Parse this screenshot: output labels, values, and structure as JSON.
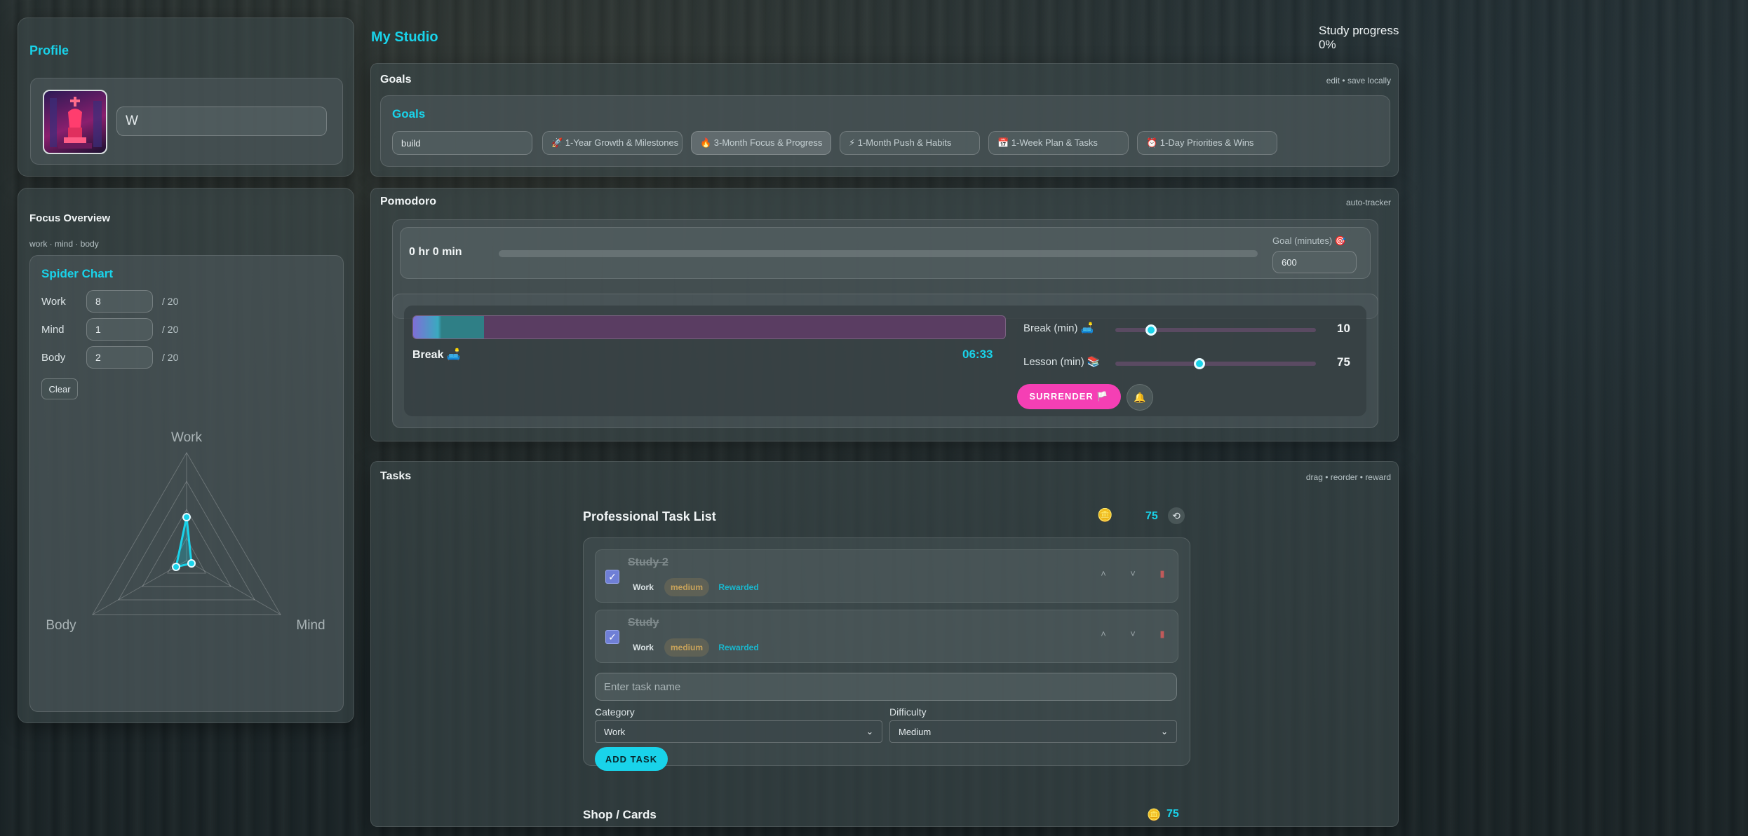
{
  "profile": {
    "title": "Profile",
    "name_value": "W"
  },
  "focus": {
    "title": "Focus Overview",
    "subtitle": "work · mind · body",
    "spider_title": "Spider Chart",
    "rows": [
      {
        "label": "Work",
        "value": "8",
        "max": "/ 20"
      },
      {
        "label": "Mind",
        "value": "1",
        "max": "/ 20"
      },
      {
        "label": "Body",
        "value": "2",
        "max": "/ 20"
      }
    ],
    "clear_label": "Clear",
    "axes": {
      "work": "Work",
      "body": "Body",
      "mind": "Mind"
    }
  },
  "header": {
    "title": "My Studio",
    "progress_label": "Study progress",
    "progress_value": "0%"
  },
  "goals": {
    "title": "Goals",
    "hint": "edit • save locally",
    "inner_title": "Goals",
    "input_value": "build",
    "chips": [
      "🚀 1-Year Growth & Milestones",
      "🔥 3-Month Focus & Progress",
      "⚡ 1-Month Push & Habits",
      "📅 1-Week Plan & Tasks",
      "⏰ 1-Day Priorities & Wins"
    ]
  },
  "pomodoro": {
    "title": "Pomodoro",
    "hint": "auto-tracker",
    "time_total": "0 hr 0 min",
    "goal_label": "Goal (minutes) 🎯",
    "goal_value": "600",
    "mode_label": "Break 🛋️",
    "timer": "06:33",
    "break_label": "Break (min) 🛋️",
    "break_value": "10",
    "lesson_label": "Lesson (min) 📚",
    "lesson_value": "75",
    "surrender_label": "SURRENDER 🏳️",
    "bell_icon": "🔔",
    "progress_fraction": 0.12,
    "break_slider_fraction": 0.18,
    "lesson_slider_fraction": 0.42
  },
  "tasks": {
    "title": "Tasks",
    "hint": "drag • reorder • reward",
    "list_title": "Professional Task List",
    "coins": "75",
    "coin_icon": "🪙",
    "reset_icon": "⟲",
    "items": [
      {
        "name": "Study 2",
        "category": "Work",
        "difficulty": "medium",
        "status": "Rewarded"
      },
      {
        "name": "Study",
        "category": "Work",
        "difficulty": "medium",
        "status": "Rewarded"
      }
    ],
    "placeholder": "Enter task name",
    "category_label": "Category",
    "category_value": "Work",
    "difficulty_label": "Difficulty",
    "difficulty_value": "Medium",
    "add_label": "ADD TASK"
  },
  "shop": {
    "title": "Shop / Cards",
    "coins": "75"
  },
  "colors": {
    "accent": "#19d3ea",
    "surrender": "#f53fb4",
    "tag_medium": "#c9a35a"
  }
}
